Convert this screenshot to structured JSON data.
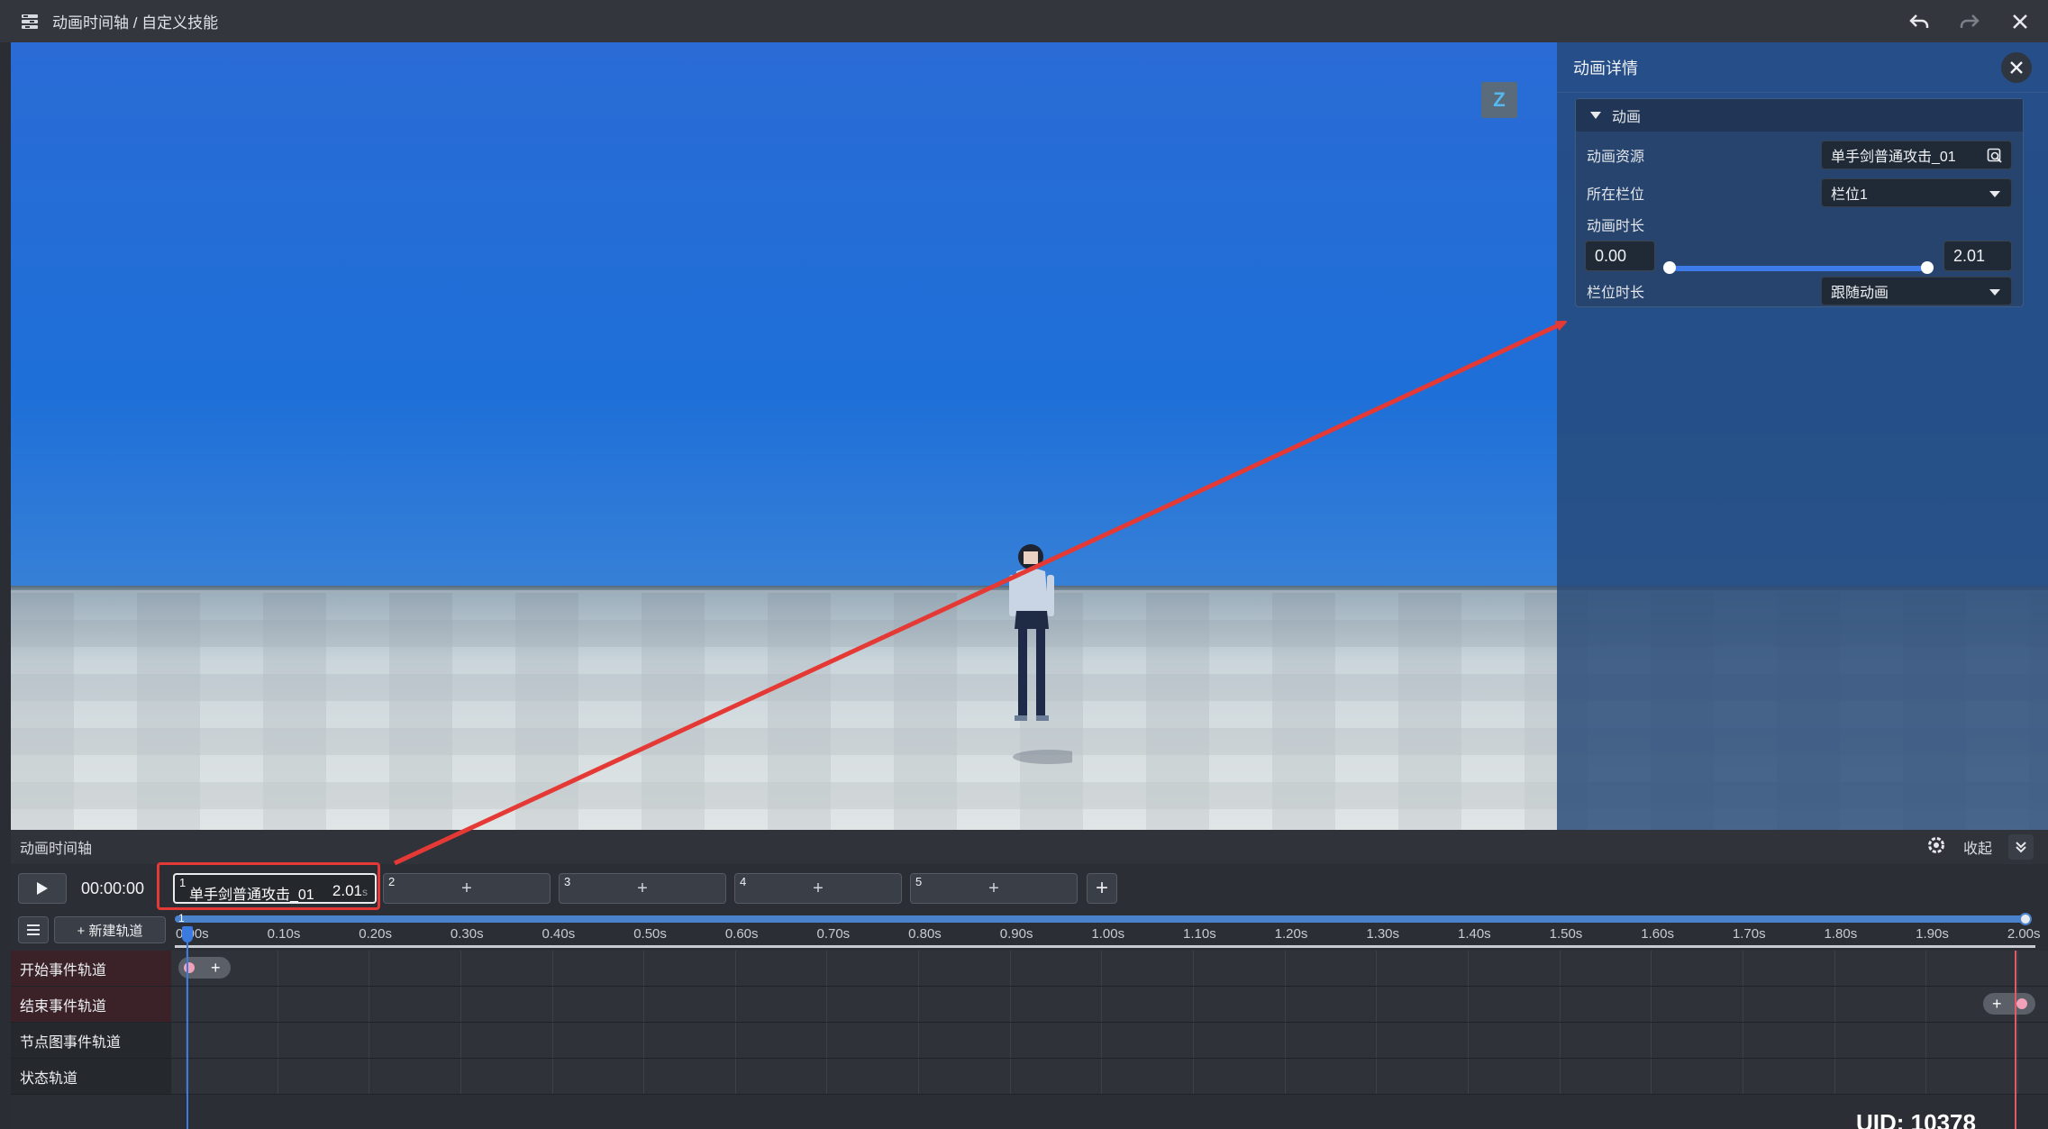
{
  "titlebar": {
    "title": "动画时间轴 / 自定义技能",
    "icons": [
      "app-menu-icon",
      "undo-icon",
      "redo-icon",
      "close-icon"
    ]
  },
  "viewport": {
    "camera_badge": "Z"
  },
  "detail_panel": {
    "title": "动画详情",
    "section_title": "动画",
    "rows": {
      "animation_asset_label": "动画资源",
      "animation_asset_value": "单手剑普通攻击_01",
      "slot_label": "所在栏位",
      "slot_value": "栏位1",
      "duration_label": "动画时长",
      "duration_start": "0.00",
      "duration_end": "2.01",
      "slot_duration_label": "栏位时长",
      "slot_duration_value": "跟随动画"
    },
    "duration_range_fraction": [
      0.0,
      1.0
    ]
  },
  "timeline": {
    "title": "动画时间轴",
    "collapse_label": "收起",
    "current_time": "00:00:00",
    "slots": [
      {
        "index": "1",
        "name": "单手剑普通攻击_01",
        "duration": "2.01",
        "unit": "s",
        "active": true
      },
      {
        "index": "2",
        "plus": "+"
      },
      {
        "index": "3",
        "plus": "+"
      },
      {
        "index": "4",
        "plus": "+"
      },
      {
        "index": "5",
        "plus": "+"
      }
    ],
    "add_slot": "+",
    "new_track_label": "+ 新建轨道",
    "start_marker": "1",
    "ticks": [
      "0.00s",
      "0.10s",
      "0.20s",
      "0.30s",
      "0.40s",
      "0.50s",
      "0.60s",
      "0.70s",
      "0.80s",
      "0.90s",
      "1.00s",
      "1.10s",
      "1.20s",
      "1.30s",
      "1.40s",
      "1.50s",
      "1.60s",
      "1.70s",
      "1.80s",
      "1.90s",
      "2.00s"
    ],
    "tracks": [
      {
        "label": "开始事件轨道",
        "kind": "event"
      },
      {
        "label": "结束事件轨道",
        "kind": "event"
      },
      {
        "label": "节点图事件轨道",
        "kind": "normal"
      },
      {
        "label": "状态轨道",
        "kind": "normal"
      }
    ],
    "pill_plus": "+"
  },
  "footer": {
    "uid": "UID: 10378"
  },
  "colors": {
    "accent_blue": "#3b7be0",
    "highlight_red": "#e53935",
    "event_track_bg": "#3a2228",
    "pink_dot": "#f1a1b8"
  }
}
